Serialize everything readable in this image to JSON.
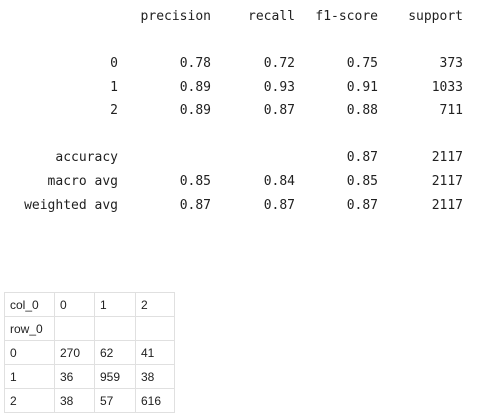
{
  "report": {
    "headers": {
      "precision": "precision",
      "recall": "recall",
      "f1": "f1-score",
      "support": "support"
    },
    "class_rows": [
      {
        "label": "0",
        "precision": "0.78",
        "recall": "0.72",
        "f1": "0.75",
        "support": "373"
      },
      {
        "label": "1",
        "precision": "0.89",
        "recall": "0.93",
        "f1": "0.91",
        "support": "1033"
      },
      {
        "label": "2",
        "precision": "0.89",
        "recall": "0.87",
        "f1": "0.88",
        "support": "711"
      }
    ],
    "accuracy": {
      "label": "accuracy",
      "f1": "0.87",
      "support": "2117"
    },
    "macro_avg": {
      "label": "macro avg",
      "precision": "0.85",
      "recall": "0.84",
      "f1": "0.85",
      "support": "2117"
    },
    "weighted_avg": {
      "label": "weighted avg",
      "precision": "0.87",
      "recall": "0.87",
      "f1": "0.87",
      "support": "2117"
    }
  },
  "crosstab": {
    "col_index_label": "col_0",
    "row_index_label": "row_0",
    "columns": [
      "0",
      "1",
      "2"
    ],
    "rows": [
      {
        "label": "0",
        "values": [
          "270",
          "62",
          "41"
        ]
      },
      {
        "label": "1",
        "values": [
          "36",
          "959",
          "38"
        ]
      },
      {
        "label": "2",
        "values": [
          "38",
          "57",
          "616"
        ]
      }
    ]
  }
}
